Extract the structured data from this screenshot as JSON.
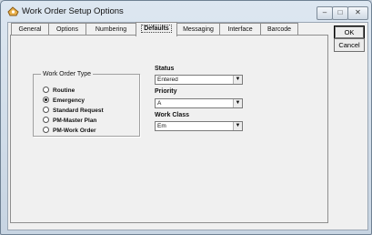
{
  "window": {
    "title": "Work Order Setup Options"
  },
  "tabs": [
    {
      "label": "General"
    },
    {
      "label": "Options"
    },
    {
      "label": "Numbering"
    },
    {
      "label": "Defaults"
    },
    {
      "label": "Messaging"
    },
    {
      "label": "Interface"
    },
    {
      "label": "Barcode"
    }
  ],
  "active_tab": "Defaults",
  "buttons": {
    "ok_label": "OK",
    "cancel_label": "Cancel"
  },
  "work_order_type": {
    "legend": "Work Order Type",
    "options": [
      {
        "label": "Routine",
        "selected": false
      },
      {
        "label": "Emergency",
        "selected": true
      },
      {
        "label": "Standard Request",
        "selected": false
      },
      {
        "label": "PM-Master Plan",
        "selected": false
      },
      {
        "label": "PM-Work Order",
        "selected": false
      }
    ]
  },
  "status": {
    "label": "Status",
    "value": "Entered"
  },
  "priority": {
    "label": "Priority",
    "value": "A"
  },
  "work_class": {
    "label": "Work Class",
    "value": "Em"
  }
}
